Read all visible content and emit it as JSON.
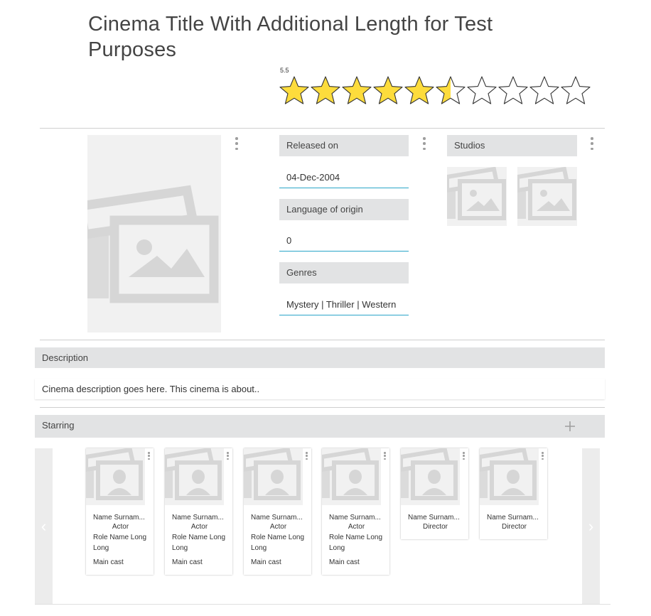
{
  "title": "Cinema Title With Additional Length for Test Purposes",
  "rating": {
    "value": "5.5",
    "score": 5.5,
    "max": 10,
    "fill_color": "#fddc3c",
    "empty_color": "#ffffff"
  },
  "details": {
    "released_label": "Released on",
    "released_value": "04-Dec-2004",
    "language_label": "Language of origin",
    "language_value": "0",
    "genres_label": "Genres",
    "genres_value": "Mystery | Thriller | Western",
    "studios_label": "Studios",
    "studios_count": 2
  },
  "description": {
    "label": "Description",
    "text": "Cinema description goes here. This cinema is about.."
  },
  "starring": {
    "label": "Starring",
    "add_icon": "plus-icon",
    "prev_icon": "chevron-left-icon",
    "next_icon": "chevron-right-icon",
    "prev_glyph": "‹",
    "next_glyph": "›",
    "cast": [
      {
        "name": "Name Surnam...",
        "type": "Actor",
        "role": "Role Name Long Long",
        "billing": "Main cast"
      },
      {
        "name": "Name Surnam...",
        "type": "Actor",
        "role": "Role Name Long Long",
        "billing": "Main cast"
      },
      {
        "name": "Name Surnam...",
        "type": "Actor",
        "role": "Role Name Long Long",
        "billing": "Main cast"
      },
      {
        "name": "Name Surnam...",
        "type": "Actor",
        "role": "Role Name Long Long",
        "billing": "Main cast"
      },
      {
        "name": "Name Surnam...",
        "type": "Director",
        "role": "",
        "billing": ""
      },
      {
        "name": "Name Surnam...",
        "type": "Director",
        "role": "",
        "billing": ""
      }
    ]
  },
  "colors": {
    "accent_underline": "#2aa5c8",
    "header_bg": "#e2e3e4",
    "placeholder_bg": "#f1f1f1",
    "placeholder_art": "#d6d6d6"
  }
}
